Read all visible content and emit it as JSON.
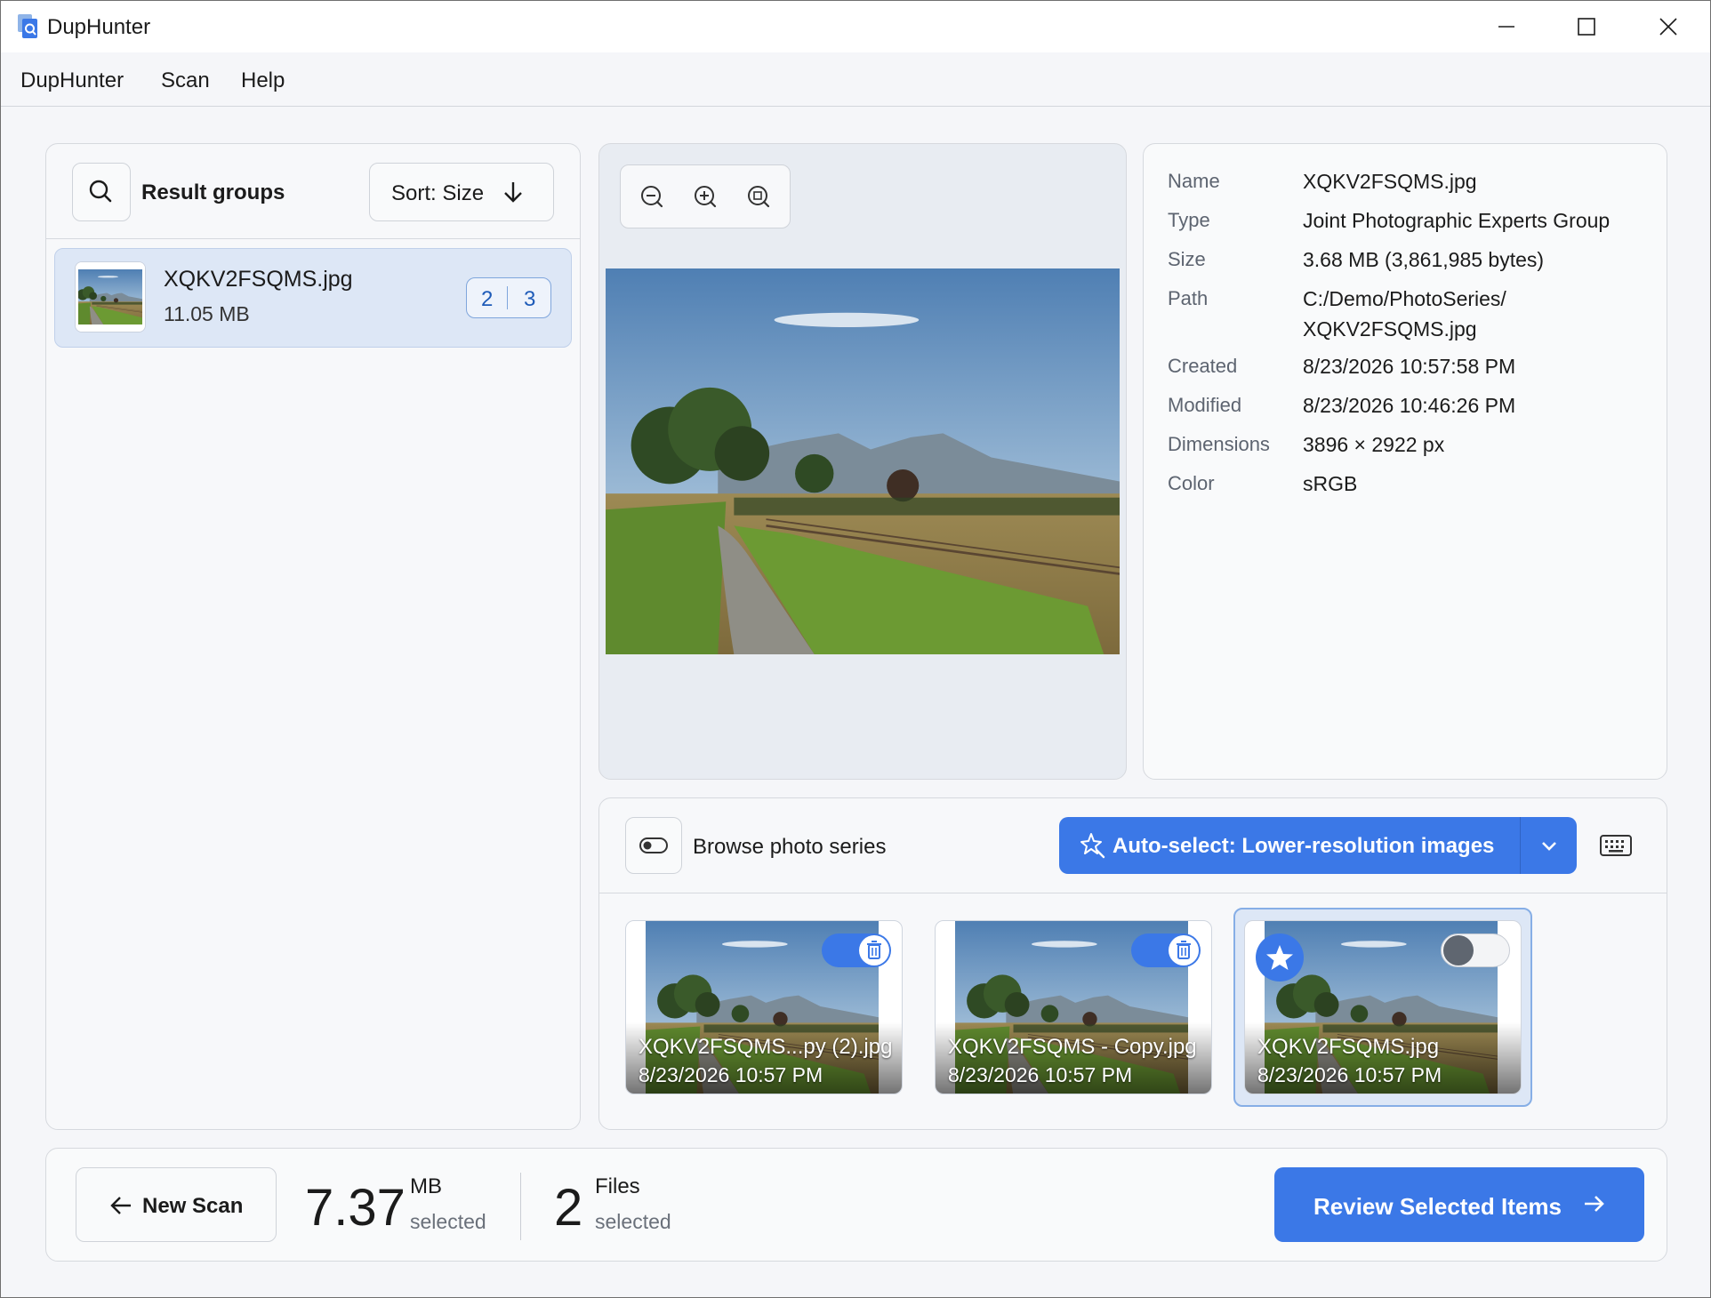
{
  "window": {
    "title": "DupHunter"
  },
  "menu": {
    "items": [
      "DupHunter",
      "Scan",
      "Help"
    ]
  },
  "results": {
    "title": "Result groups",
    "sort_label": "Sort: Size",
    "groups": [
      {
        "name": "XQKV2FSQMS.jpg",
        "size": "11.05 MB",
        "count_a": "2",
        "count_b": "3"
      }
    ]
  },
  "properties": {
    "rows": [
      {
        "label": "Name",
        "value": "XQKV2FSQMS.jpg"
      },
      {
        "label": "Type",
        "value": "Joint Photographic Experts Group"
      },
      {
        "label": "Size",
        "value": "3.68 MB (3,861,985 bytes)"
      },
      {
        "label": "Path",
        "value": "C:/Demo/PhotoSeries/",
        "value2": "XQKV2FSQMS.jpg"
      },
      {
        "label": "Created",
        "value": "8/23/2026 10:57:58 PM"
      },
      {
        "label": "Modified",
        "value": "8/23/2026 10:46:26 PM"
      },
      {
        "label": "Dimensions",
        "value": "3896 × 2922 px"
      },
      {
        "label": "Color",
        "value": "sRGB"
      }
    ]
  },
  "series": {
    "browse_label": "Browse photo series",
    "autoselect_label": "Auto-select: Lower-resolution images",
    "cards": [
      {
        "name": "XQKV2FSQMS...py (2).jpg",
        "date": "8/23/2026 10:57 PM",
        "selected_for_delete": true,
        "preferred": false
      },
      {
        "name": "XQKV2FSQMS - Copy.jpg",
        "date": "8/23/2026 10:57 PM",
        "selected_for_delete": true,
        "preferred": false
      },
      {
        "name": "XQKV2FSQMS.jpg",
        "date": "8/23/2026 10:57 PM",
        "selected_for_delete": false,
        "preferred": true
      }
    ]
  },
  "footer": {
    "new_scan": "New Scan",
    "size_value": "7.37",
    "size_unit": "MB",
    "size_caption": "selected",
    "files_value": "2",
    "files_unit": "Files",
    "files_caption": "selected",
    "review_label": "Review Selected Items"
  },
  "colors": {
    "accent": "#3b78e7",
    "selected_row": "#dde7f6"
  }
}
